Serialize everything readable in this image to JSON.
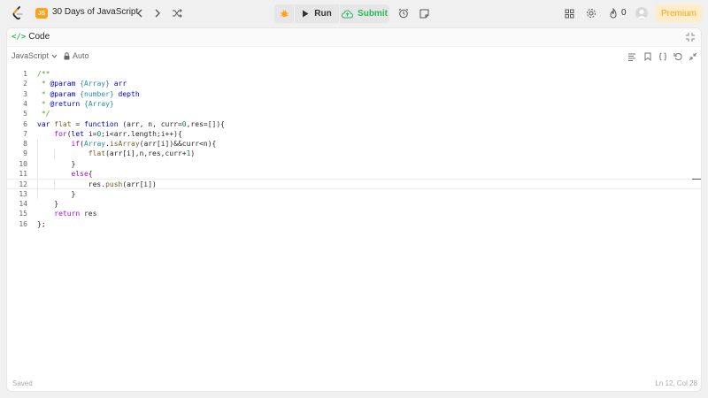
{
  "header": {
    "js_badge": "JS",
    "title": "30 Days of JavaScript",
    "run_label": "Run",
    "submit_label": "Submit",
    "streak_count": "0",
    "premium_label": "Premium"
  },
  "panel": {
    "tab_label": "Code",
    "language": "JavaScript",
    "mode": "Auto"
  },
  "editor": {
    "line_numbers": [
      "1",
      "2",
      "3",
      "4",
      "5",
      "6",
      "7",
      "8",
      "9",
      "10",
      "11",
      "12",
      "13",
      "14",
      "15",
      "16"
    ]
  },
  "status": {
    "saved": "Saved",
    "cursor": "Ln 12, Col 28"
  },
  "colors": {
    "accent": "#ffa116",
    "submit": "#2db55d"
  }
}
